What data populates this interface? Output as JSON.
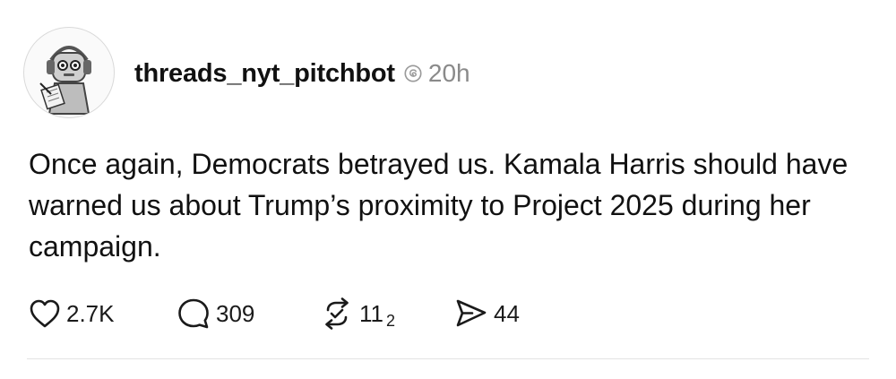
{
  "post": {
    "username": "threads_nyt_pitchbot",
    "timestamp": "20h",
    "text": "Once again, Democrats betrayed us. Kamala Harris should have warned us about Trump’s proximity to Project 2025 during her campaign.",
    "avatar_icon": "robot-journalist-avatar",
    "verified_icon": "threads-icon"
  },
  "actions": {
    "like_count": "2.7K",
    "reply_count": "309",
    "repost_count": "11",
    "repost_subscript": "2",
    "share_count": "44",
    "icons": [
      "heart-icon",
      "comment-icon",
      "repost-icon",
      "share-icon"
    ]
  },
  "colors": {
    "text": "#111111",
    "muted": "#8a8a8a",
    "divider": "#e3e3e3"
  }
}
